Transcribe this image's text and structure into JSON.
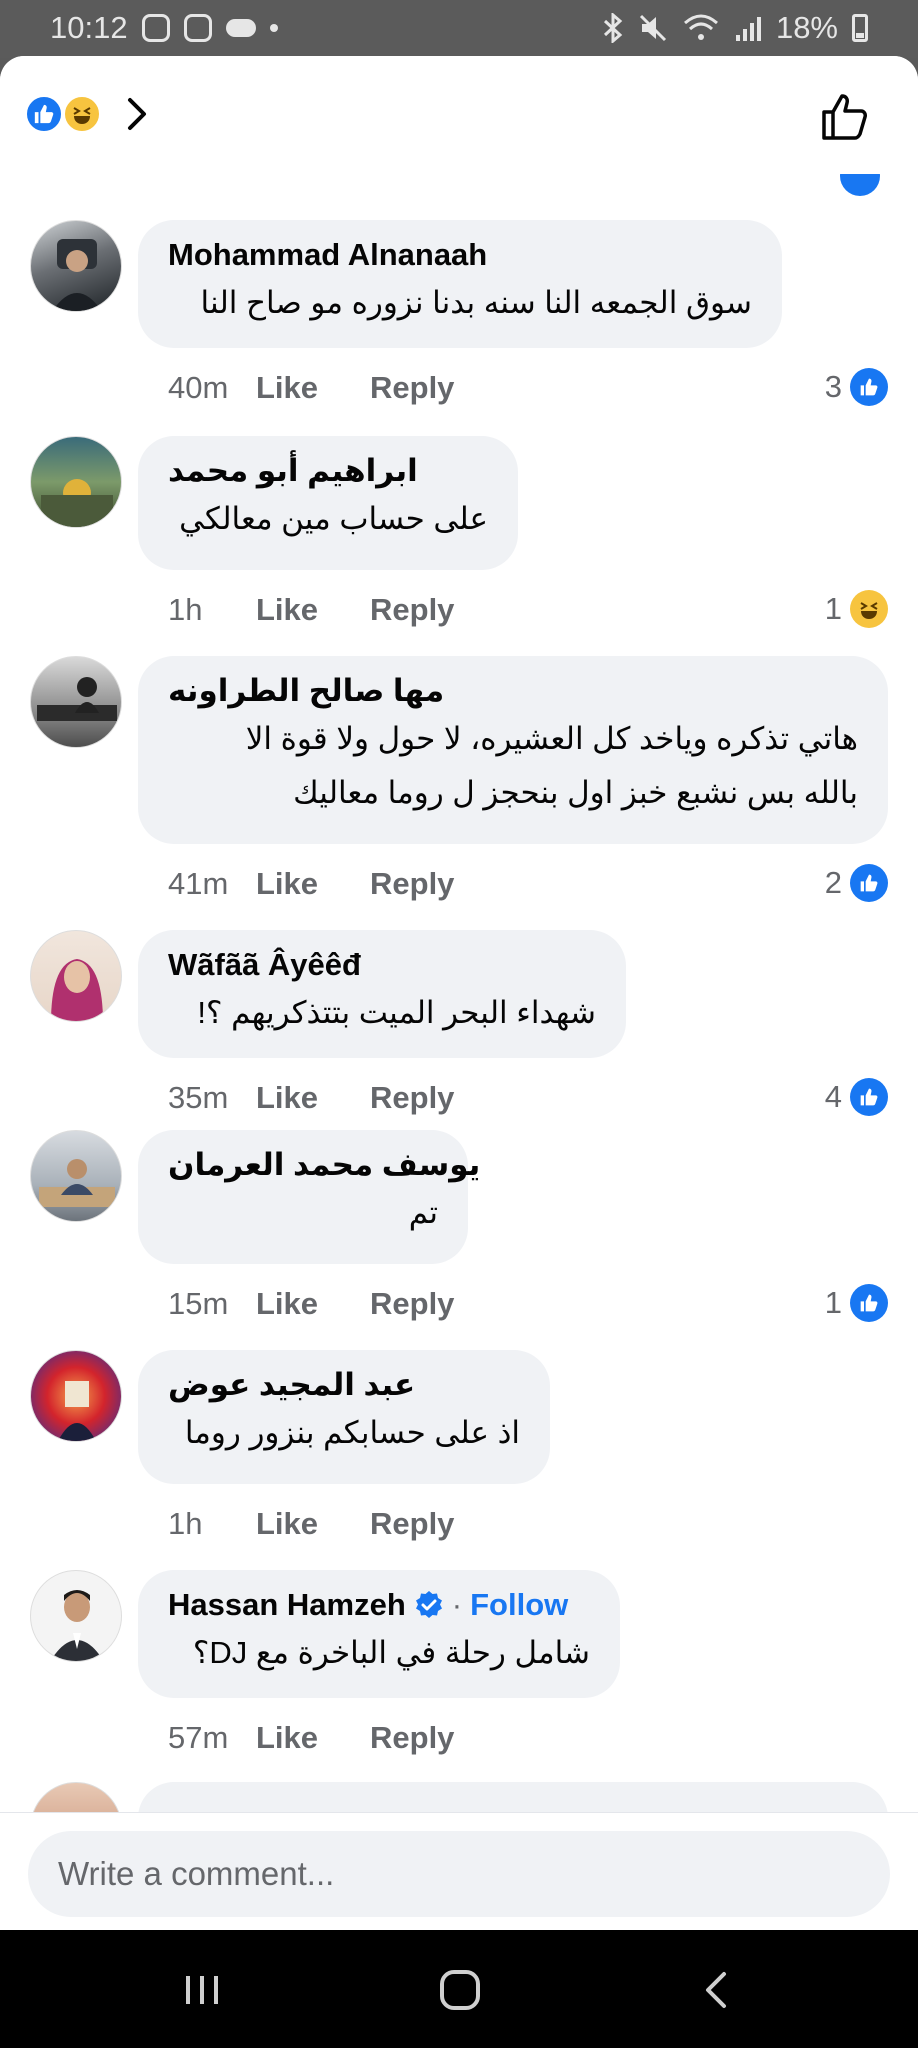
{
  "status_bar": {
    "time": "10:12",
    "battery": "18%",
    "icons": [
      "instagram-icon",
      "instagram-icon",
      "cloud-icon",
      "dot-icon",
      "bluetooth-icon",
      "mute-icon",
      "wifi-icon",
      "signal-icon",
      "battery-icon"
    ]
  },
  "header": {
    "reactions": [
      "like",
      "haha"
    ],
    "chevron": "chevron-right-icon",
    "like_button_icon": "thumbs-up-outline-icon"
  },
  "comments": [
    {
      "name": "Mohammad Alnanaah",
      "name_rtl": false,
      "text_lines": [
        "سوق الجمعه النا سنه بدنا نزوره مو صاح النا"
      ],
      "time": "40m",
      "like": "Like",
      "reply": "Reply",
      "reaction_count": "3",
      "reaction_type": "like"
    },
    {
      "name": "ابراهيم أبو محمد",
      "name_rtl": true,
      "text_lines": [
        "على حساب مين معالكي"
      ],
      "time": "1h",
      "like": "Like",
      "reply": "Reply",
      "reaction_count": "1",
      "reaction_type": "haha"
    },
    {
      "name": "مها صالح الطراونه",
      "name_rtl": true,
      "text_lines": [
        "هاتي تذكره وياخد كل العشيره، لا حول ولا قوة الا",
        "بالله بس نشبع خبز اول بنحجز ل روما معاليك"
      ],
      "time": "41m",
      "like": "Like",
      "reply": "Reply",
      "reaction_count": "2",
      "reaction_type": "like"
    },
    {
      "name": "Wãfãã Âyêêđ",
      "name_rtl": false,
      "text_lines": [
        "شهداء البحر الميت بتتذكريهم ؟!"
      ],
      "time": "35m",
      "like": "Like",
      "reply": "Reply",
      "reaction_count": "4",
      "reaction_type": "like"
    },
    {
      "name": "يوسف محمد العرمان",
      "name_rtl": true,
      "text_lines": [
        "تم"
      ],
      "time": "15m",
      "like": "Like",
      "reply": "Reply",
      "reaction_count": "1",
      "reaction_type": "like"
    },
    {
      "name": "عبد المجيد عوض",
      "name_rtl": true,
      "text_lines": [
        "اذ على حسابكم بنزور روما"
      ],
      "time": "1h",
      "like": "Like",
      "reply": "Reply",
      "reaction_count": "",
      "reaction_type": ""
    },
    {
      "name": "Hassan Hamzeh",
      "name_rtl": false,
      "verified": true,
      "follow": "Follow",
      "separator": "·",
      "text_lines": [
        "شامل رحلة في الباخرة مع DJ؟"
      ],
      "time": "57m",
      "like": "Like",
      "reply": "Reply",
      "reaction_count": "",
      "reaction_type": ""
    }
  ],
  "composer": {
    "placeholder": "Write a comment..."
  },
  "navbar": {
    "buttons": [
      "recent-apps-icon",
      "home-icon",
      "back-icon"
    ]
  },
  "colors": {
    "facebook_blue": "#1877f2",
    "bubble_bg": "#f0f2f5",
    "secondary_text": "#65676b",
    "haha_yellow": "#f7c43f"
  }
}
